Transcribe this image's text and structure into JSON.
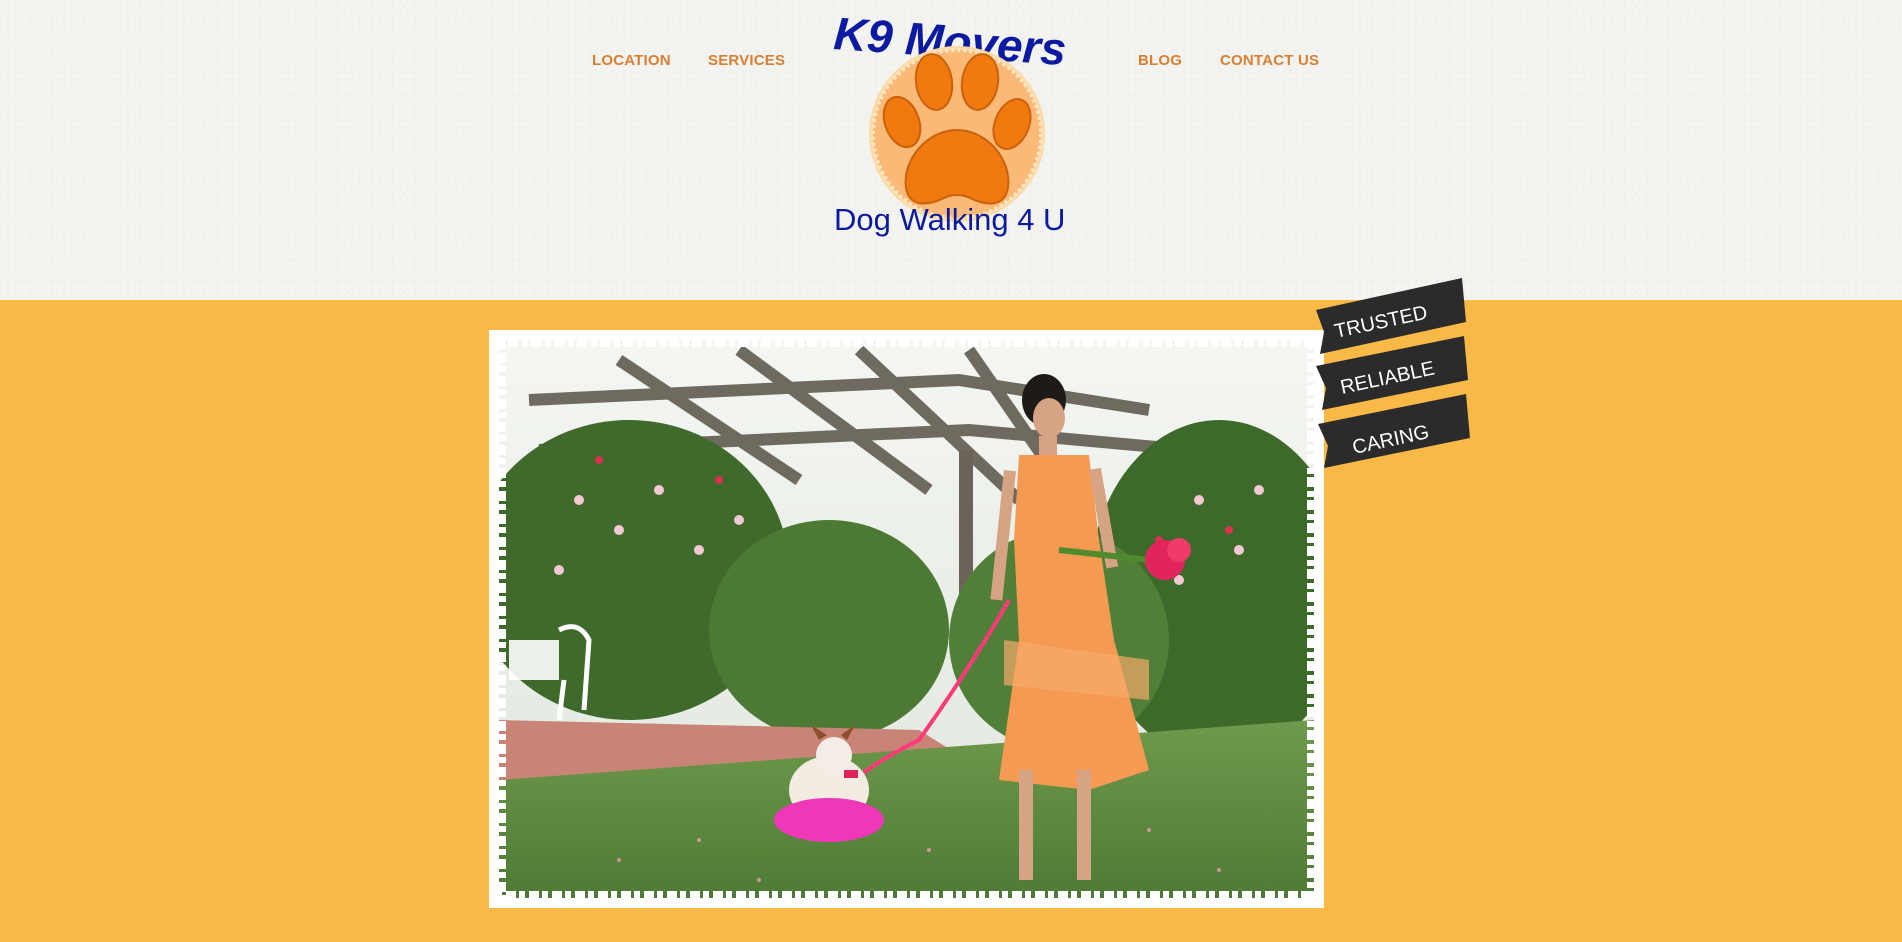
{
  "nav": {
    "location": "LOCATION",
    "services": "SERVICES",
    "blog": "BLOG",
    "contact": "CONTACT US"
  },
  "logo": {
    "title": "K9 Movers",
    "subtitle": "Dog Walking 4 U",
    "icon": "paw-icon"
  },
  "badges": [
    "TRUSTED",
    "RELIABLE",
    "CARING"
  ],
  "colors": {
    "accent": "#d97f33",
    "background": "#f8b946",
    "header": "#f3f3f0",
    "logo_blue": "#0b1aa0",
    "paw_orange": "#f07a10",
    "badge_dark": "#2b2b2b"
  }
}
